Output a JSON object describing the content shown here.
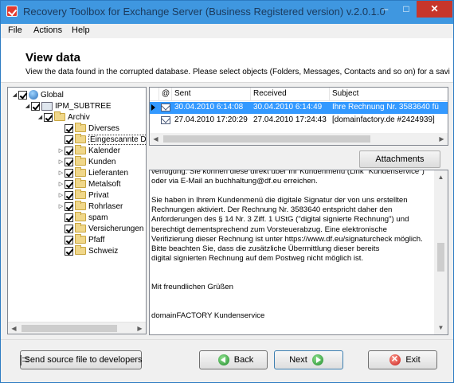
{
  "window": {
    "title": "Recovery Toolbox for Exchange Server (Business Registered version) v.2.0.1.0",
    "minimize_glyph": "–",
    "maximize_glyph": "□",
    "close_glyph": "✕"
  },
  "menu": {
    "file_label": "File",
    "actions_label": "Actions",
    "help_label": "Help"
  },
  "header": {
    "title": "View data",
    "description": "View the data found in the corrupted database. Please select objects (Folders, Messages, Contacts and so on) for a savi"
  },
  "tree": {
    "global": "Global",
    "ipm_subtree": "IPM_SUBTREE",
    "archiv": "Archiv",
    "items": [
      "Diverses",
      "Eingescannte De",
      "Kalender",
      "Kunden",
      "Lieferanten",
      "Metalsoft",
      "Privat",
      "Rohrlaser",
      "spam",
      "Versicherungen",
      "Pfaff",
      "Schweiz"
    ]
  },
  "message_list": {
    "columns": [
      "@",
      "Sent",
      "Received",
      "Subject"
    ],
    "rows": [
      {
        "sent": "30.04.2010 6:14:08",
        "received": "30.04.2010 6:14:49",
        "subject": "Ihre Rechnung Nr. 3583640 fü"
      },
      {
        "sent": "27.04.2010 17:20:29",
        "received": "27.04.2010 17:24:43",
        "subject": "[domainfactory.de #2424939]"
      }
    ]
  },
  "attachments_label": "Attachments",
  "message_body": {
    "lines": [
      "verfügung. Sie können diese direkt über Ihr Kundenmenü (Link \"Kundenservice\")",
      "oder via E-Mail an buchhaltung@df.eu erreichen.",
      "",
      "Sie haben in Ihrem Kundenmenü die digitale Signatur der von uns erstellten",
      "Rechnungen aktiviert. Der Rechnung Nr. 3583640 entspricht daher den",
      "Anforderungen des § 14 Nr. 3 Ziff. 1 UStG (\"digital signierte Rechnung\") und",
      "berechtigt dementsprechend zum Vorsteuerabzug. Eine elektronische",
      "Verifizierung dieser Rechnung ist unter https://www.df.eu/signaturcheck möglich.",
      "Bitte beachten Sie, dass die zusätzliche Übermittlung dieser bereits",
      "digital signierten Rechnung auf dem Postweg nicht möglich ist.",
      "",
      "",
      "Mit freundlichen Grüßen",
      "",
      "",
      "domainFACTORY Kundenservice"
    ]
  },
  "footer": {
    "send_label": "Send source file to developers",
    "back_label": "Back",
    "next_label": "Next",
    "exit_label": "Exit"
  }
}
